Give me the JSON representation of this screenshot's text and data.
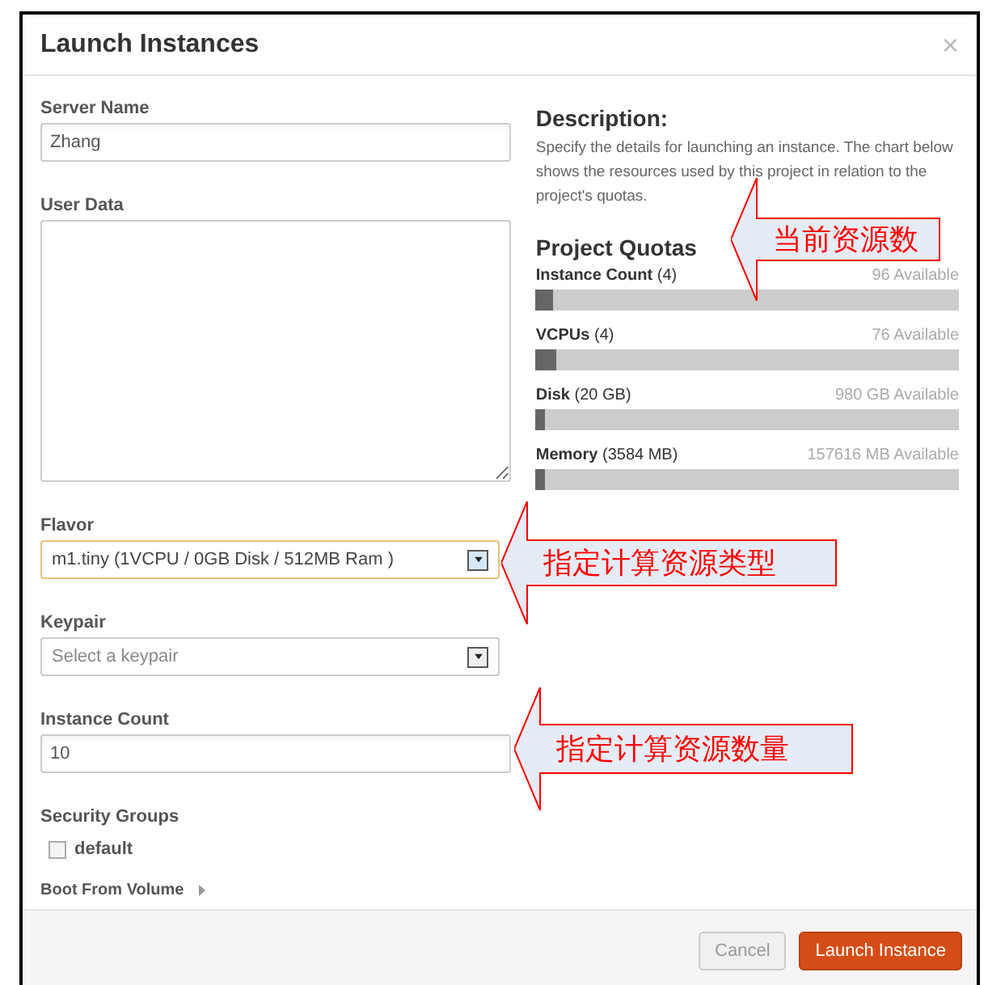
{
  "dialog": {
    "title": "Launch Instances",
    "close": "×"
  },
  "fields": [
    {
      "kind": "text",
      "label": "Server Name",
      "value": "Zhang"
    },
    {
      "kind": "textarea",
      "label": "User Data"
    },
    {
      "kind": "select",
      "label": "Flavor",
      "value": "m1.tiny (1VCPU / 0GB Disk / 512MB Ram )",
      "focused": true
    },
    {
      "kind": "select",
      "label": "Keypair",
      "placeholder": "Select a keypair",
      "focused": false
    },
    {
      "kind": "text",
      "label": "Instance Count",
      "value": "10"
    },
    {
      "kind": "checkboxes",
      "label": "Security Groups",
      "options": [
        {
          "label": "default",
          "checked": false
        }
      ]
    },
    {
      "kind": "expander",
      "label": "Boot From Volume",
      "expanded": false
    }
  ],
  "description": {
    "title": "Description:",
    "text": "Specify the details for launching an instance. The chart below shows the resources used by this project in relation to the project's quotas."
  },
  "quotas": {
    "title": "Project Quotas",
    "items": [
      {
        "label": "Instance Count",
        "amount": "(4)",
        "available": "96 Available",
        "level": 0.04
      },
      {
        "label": "VCPUs",
        "amount": "(4)",
        "available": "76 Available",
        "level": 0.05
      },
      {
        "label": "Disk",
        "amount": "(20 GB)",
        "available": "980 GB Available",
        "level": 0.02
      },
      {
        "label": "Memory",
        "amount": "(3584 MB)",
        "available": "157616 MB Available",
        "level": 0.022
      }
    ]
  },
  "buttons": [
    {
      "label": "Cancel",
      "kind": "secondary"
    },
    {
      "label": "Launch Instance",
      "kind": "primary"
    }
  ],
  "annotations": [
    {
      "text": "当前资源数"
    },
    {
      "text": "指定计算资源类型"
    },
    {
      "text": "指定计算资源数量"
    }
  ]
}
